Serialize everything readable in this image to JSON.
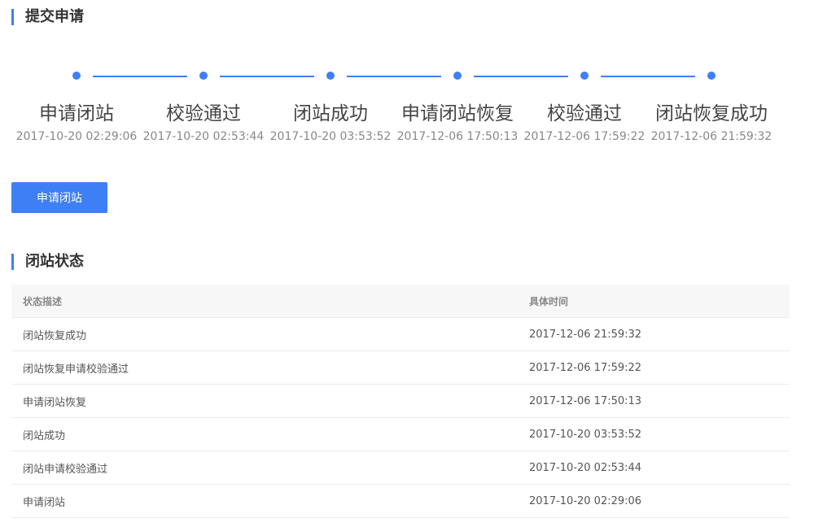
{
  "submit_section": {
    "title": "提交申请"
  },
  "steps": [
    {
      "label": "申请闭站",
      "time": "2017-10-20 02:29:06"
    },
    {
      "label": "校验通过",
      "time": "2017-10-20 02:53:44"
    },
    {
      "label": "闭站成功",
      "time": "2017-10-20 03:53:52"
    },
    {
      "label": "申请闭站恢复",
      "time": "2017-12-06 17:50:13"
    },
    {
      "label": "校验通过",
      "time": "2017-12-06 17:59:22"
    },
    {
      "label": "闭站恢复成功",
      "time": "2017-12-06 21:59:32"
    }
  ],
  "apply_button": {
    "label": "申请闭站"
  },
  "status_section": {
    "title": "闭站状态"
  },
  "table": {
    "headers": [
      "状态描述",
      "具体时间"
    ],
    "rows": [
      [
        "闭站恢复成功",
        "2017-12-06 21:59:32"
      ],
      [
        "闭站恢复申请校验通过",
        "2017-12-06 17:59:22"
      ],
      [
        "申请闭站恢复",
        "2017-12-06 17:50:13"
      ],
      [
        "闭站成功",
        "2017-10-20 03:53:52"
      ],
      [
        "闭站申请校验通过",
        "2017-10-20 02:53:44"
      ],
      [
        "申请闭站",
        "2017-10-20 02:29:06"
      ]
    ]
  },
  "colors": {
    "accent": "#3f7ff5"
  }
}
